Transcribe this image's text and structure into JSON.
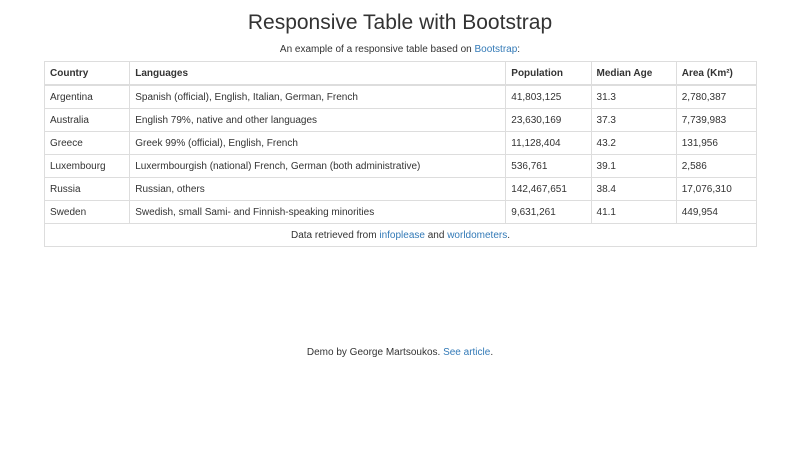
{
  "page": {
    "title": "Responsive Table with Bootstrap",
    "caption_prefix": "An example of a responsive table based on ",
    "caption_link": "Bootstrap",
    "caption_suffix": ":"
  },
  "table": {
    "headers": {
      "country": "Country",
      "languages": "Languages",
      "population": "Population",
      "median_age": "Median Age",
      "area": "Area (Km²)"
    },
    "rows": [
      {
        "country": "Argentina",
        "languages": "Spanish (official), English, Italian, German, French",
        "population": "41,803,125",
        "median_age": "31.3",
        "area": "2,780,387"
      },
      {
        "country": "Australia",
        "languages": "English 79%, native and other languages",
        "population": "23,630,169",
        "median_age": "37.3",
        "area": "7,739,983"
      },
      {
        "country": "Greece",
        "languages": "Greek 99% (official), English, French",
        "population": "11,128,404",
        "median_age": "43.2",
        "area": "131,956"
      },
      {
        "country": "Luxembourg",
        "languages": "Luxermbourgish (national) French, German (both administrative)",
        "population": "536,761",
        "median_age": "39.1",
        "area": "2,586"
      },
      {
        "country": "Russia",
        "languages": "Russian, others",
        "population": "142,467,651",
        "median_age": "38.4",
        "area": "17,076,310"
      },
      {
        "country": "Sweden",
        "languages": "Swedish, small Sami- and Finnish-speaking minorities",
        "population": "9,631,261",
        "median_age": "41.1",
        "area": "449,954"
      }
    ],
    "footer": {
      "prefix": "Data retrieved from ",
      "link1": "infoplease",
      "middle": " and ",
      "link2": "worldometers",
      "suffix": "."
    }
  },
  "credit": {
    "prefix": "Demo by George Martsoukos. ",
    "link": "See article",
    "suffix": "."
  },
  "colors": {
    "link": "#337ab7",
    "text": "#333333",
    "border": "#dddddd"
  }
}
